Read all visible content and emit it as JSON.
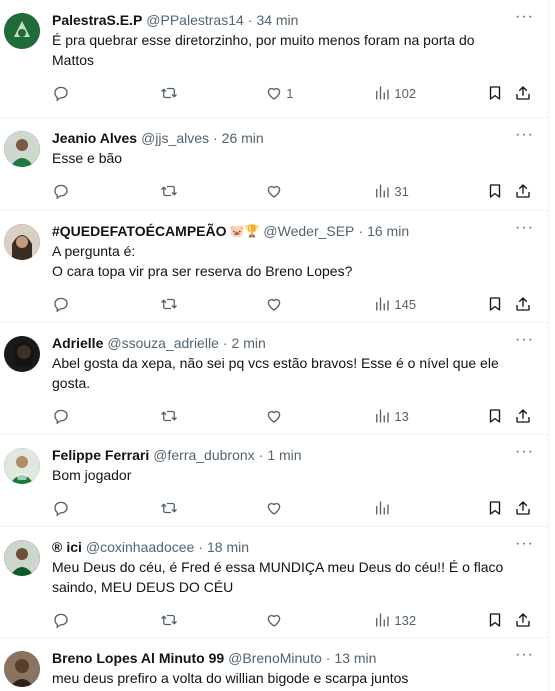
{
  "tweets": [
    {
      "name": "PalestraS.E.P",
      "handle": "@PPalestras14",
      "time": "34 min",
      "text": "É pra quebrar esse diretorzinho, por muito menos foram na porta do Mattos",
      "replies": "",
      "retweets": "",
      "likes": "1",
      "views": "102",
      "avatar_color": "#1f6b3a"
    },
    {
      "name": "Jeanio Alves",
      "handle": "@jjs_alves",
      "time": "26 min",
      "text": "Esse e bão",
      "replies": "",
      "retweets": "",
      "likes": "",
      "views": "31",
      "avatar_color": "#3d6e4a"
    },
    {
      "name": "#QUEDEFATOÉCAMPEÃO",
      "name_emoji": "🐷🏆",
      "handle": "@Weder_SEP",
      "time": "16 min",
      "text": "A pergunta é:\nO cara topa vir pra ser reserva do Breno Lopes?",
      "replies": "",
      "retweets": "",
      "likes": "",
      "views": "145",
      "avatar_color": "#8a7462"
    },
    {
      "name": "Adrielle",
      "handle": "@ssouza_adrielle",
      "time": "2 min",
      "text": "Abel gosta da xepa, não sei pq vcs estão bravos! Esse é o nível que ele gosta.",
      "replies": "",
      "retweets": "",
      "likes": "",
      "views": "13",
      "avatar_color": "#2b2b2b"
    },
    {
      "name": "Felippe Ferrari",
      "handle": "@ferra_dubronx",
      "time": "1 min",
      "text": "Bom jogador",
      "replies": "",
      "retweets": "",
      "likes": "",
      "views": "",
      "avatar_color": "#4a8c5c"
    },
    {
      "name": "ici",
      "name_prefix": "®",
      "handle": "@coxinhaadocee",
      "time": "18 min",
      "text": "Meu Deus do céu, é Fred é essa MUNDIÇA meu Deus do céu!! É o flaco saindo, MEU DEUS DO CÉU",
      "replies": "",
      "retweets": "",
      "likes": "",
      "views": "132",
      "avatar_color": "#2f5e3b"
    },
    {
      "name": "Breno Lopes Al Minuto 99",
      "handle": "@BrenoMinuto",
      "time": "13 min",
      "text": "meu deus prefiro a volta do willian bigode e scarpa juntos",
      "replies": "",
      "retweets": "",
      "likes": "",
      "views": "",
      "avatar_color": "#6b5a48"
    }
  ],
  "ui": {
    "dot": "·",
    "more": "···",
    "icons": {
      "reply": "reply-icon",
      "retweet": "retweet-icon",
      "like": "heart-icon",
      "views": "views-icon",
      "bookmark": "bookmark-icon",
      "share": "share-icon"
    }
  }
}
